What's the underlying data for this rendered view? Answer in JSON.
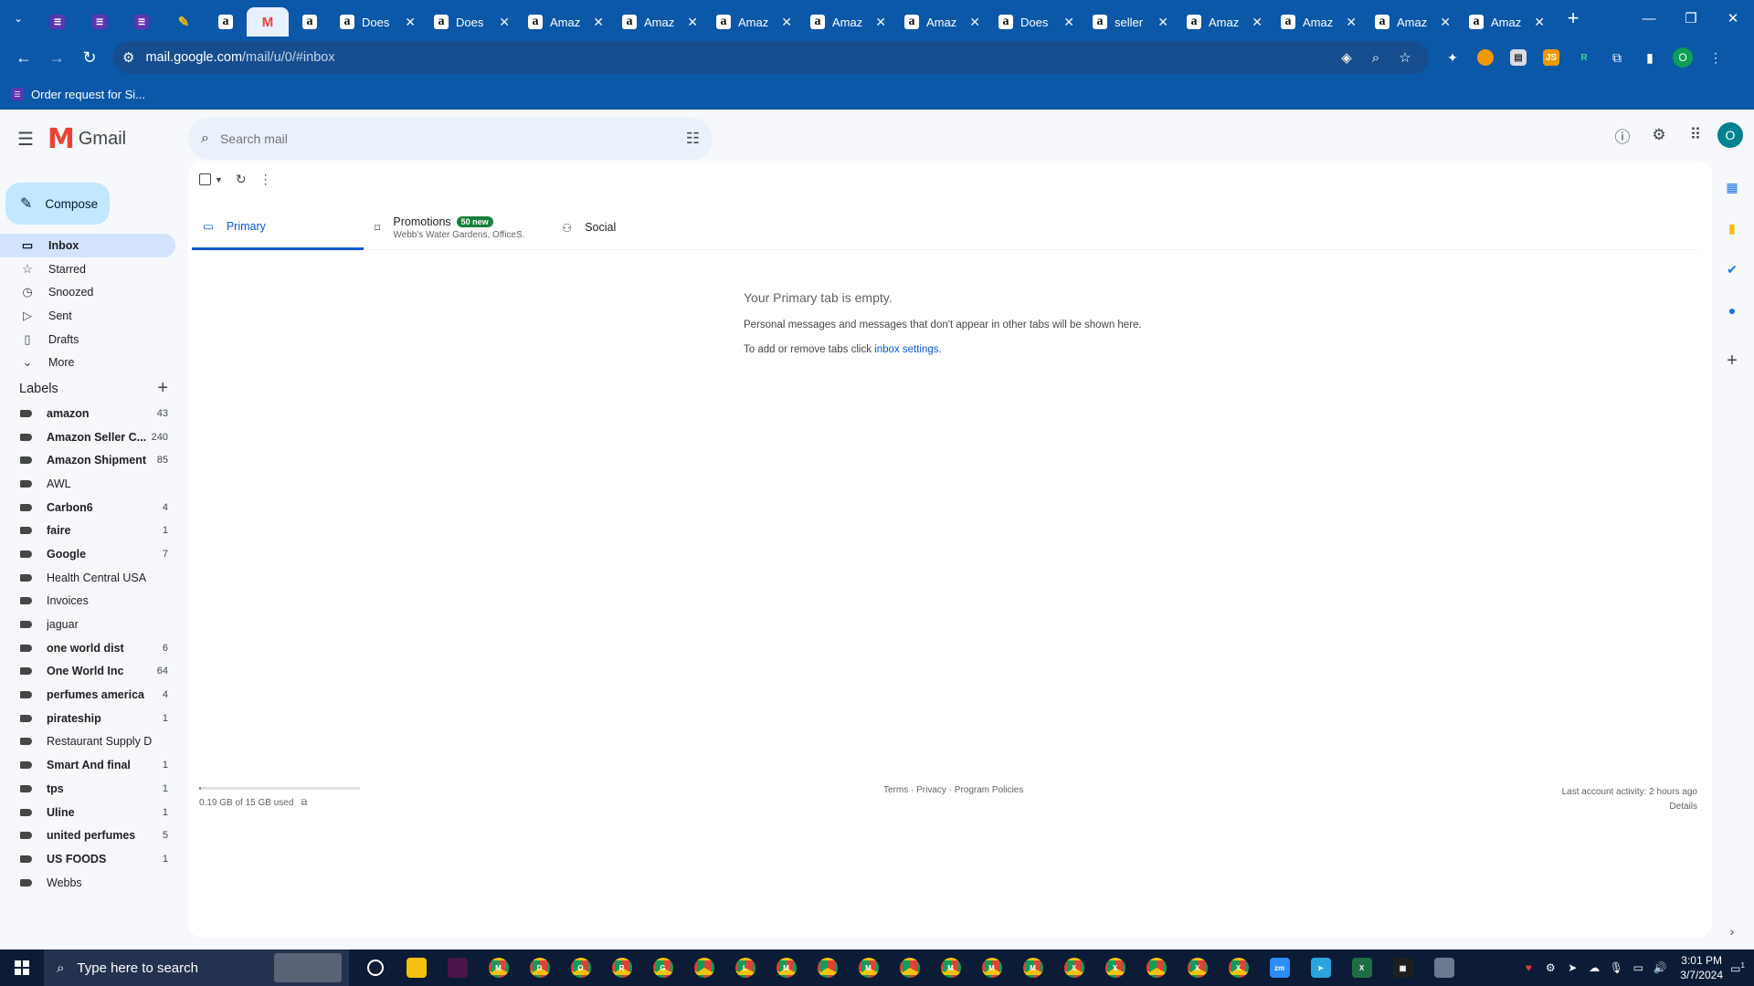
{
  "browser": {
    "tabs": [
      {
        "icon": "tab-search-icon",
        "title": "",
        "kind": "menu"
      },
      {
        "icon": "list-icon",
        "title": "",
        "kind": "pinned"
      },
      {
        "icon": "list-icon",
        "title": "",
        "kind": "pinned"
      },
      {
        "icon": "list-icon",
        "title": "",
        "kind": "pinned"
      },
      {
        "icon": "pen-icon",
        "title": "",
        "kind": "pinned"
      },
      {
        "icon": "amazon-icon",
        "title": "",
        "kind": "pinned"
      },
      {
        "icon": "gmail-icon",
        "title": "",
        "kind": "pinned-active"
      },
      {
        "icon": "amazon-icon",
        "title": "",
        "kind": "pinned"
      },
      {
        "icon": "amazon-icon",
        "title": "Does",
        "kind": "normal"
      },
      {
        "icon": "amazon-icon",
        "title": "Does",
        "kind": "normal"
      },
      {
        "icon": "amazon-icon",
        "title": "Amaz",
        "kind": "normal"
      },
      {
        "icon": "amazon-icon",
        "title": "Amaz",
        "kind": "normal"
      },
      {
        "icon": "amazon-icon",
        "title": "Amaz",
        "kind": "normal"
      },
      {
        "icon": "amazon-icon",
        "title": "Amaz",
        "kind": "normal"
      },
      {
        "icon": "amazon-icon",
        "title": "Amaz",
        "kind": "normal"
      },
      {
        "icon": "amazon-icon",
        "title": "Does",
        "kind": "normal"
      },
      {
        "icon": "amazon-icon",
        "title": "seller",
        "kind": "normal"
      },
      {
        "icon": "amazon-icon",
        "title": "Amaz",
        "kind": "normal"
      },
      {
        "icon": "amazon-icon",
        "title": "Amaz",
        "kind": "normal"
      },
      {
        "icon": "amazon-icon",
        "title": "Amaz",
        "kind": "normal"
      },
      {
        "icon": "amazon-icon",
        "title": "Amaz",
        "kind": "normal"
      }
    ],
    "new_tab_label": "+",
    "url_host": "mail.google.com",
    "url_path": "/mail/u/0/#inbox",
    "profile_initial": "O",
    "bookmark": "Order request for Si..."
  },
  "gmail": {
    "product": "Gmail",
    "compose": "Compose",
    "search_placeholder": "Search mail",
    "avatar_initial": "O",
    "nav": [
      {
        "label": "Inbox",
        "icon": "inbox-icon",
        "glyph": "▭",
        "active": true
      },
      {
        "label": "Starred",
        "icon": "star-icon",
        "glyph": "☆",
        "active": false
      },
      {
        "label": "Snoozed",
        "icon": "clock-icon",
        "glyph": "◷",
        "active": false
      },
      {
        "label": "Sent",
        "icon": "send-icon",
        "glyph": "▷",
        "active": false
      },
      {
        "label": "Drafts",
        "icon": "draft-icon",
        "glyph": "▯",
        "active": false
      },
      {
        "label": "More",
        "icon": "chevron-down-icon",
        "glyph": "⌄",
        "active": false
      }
    ],
    "labels_title": "Labels",
    "labels": [
      {
        "name": "amazon",
        "count": "43",
        "unread": true
      },
      {
        "name": "Amazon Seller C...",
        "count": "240",
        "unread": true
      },
      {
        "name": "Amazon Shipment",
        "count": "85",
        "unread": true
      },
      {
        "name": "AWL",
        "count": "",
        "unread": false
      },
      {
        "name": "Carbon6",
        "count": "4",
        "unread": true
      },
      {
        "name": "faire",
        "count": "1",
        "unread": true
      },
      {
        "name": "Google",
        "count": "7",
        "unread": true
      },
      {
        "name": "Health Central USA",
        "count": "",
        "unread": false
      },
      {
        "name": "Invoices",
        "count": "",
        "unread": false
      },
      {
        "name": "jaguar",
        "count": "",
        "unread": false
      },
      {
        "name": "one world dist",
        "count": "6",
        "unread": true
      },
      {
        "name": "One World Inc",
        "count": "64",
        "unread": true
      },
      {
        "name": "perfumes america",
        "count": "4",
        "unread": true
      },
      {
        "name": "pirateship",
        "count": "1",
        "unread": true
      },
      {
        "name": "Restaurant Supply D",
        "count": "",
        "unread": false
      },
      {
        "name": "Smart And final",
        "count": "1",
        "unread": true
      },
      {
        "name": "tps",
        "count": "1",
        "unread": true
      },
      {
        "name": "Uline",
        "count": "1",
        "unread": true
      },
      {
        "name": "united perfumes",
        "count": "5",
        "unread": true
      },
      {
        "name": "US FOODS",
        "count": "1",
        "unread": true
      },
      {
        "name": "Webbs",
        "count": "",
        "unread": false
      }
    ],
    "tabs": {
      "primary": "Primary",
      "promotions": "Promotions",
      "promotions_badge": "50 new",
      "promotions_snippet": "Webb's Water Gardens, OfficeS...",
      "social": "Social"
    },
    "empty": {
      "heading": "Your Primary tab is empty.",
      "line1": "Personal messages and messages that don't appear in other tabs will be shown here.",
      "line2_prefix": "To add or remove tabs click ",
      "line2_link": "inbox settings",
      "line2_suffix": "."
    },
    "footer": {
      "storage": "0.19 GB of 15 GB used",
      "storage_fraction": 0.013,
      "links": "Terms · Privacy · Program Policies",
      "activity": "Last account activity: 2 hours ago",
      "details": "Details"
    }
  },
  "taskbar": {
    "search_placeholder": "Type here to search",
    "apps": [
      {
        "icon": "cortana-icon",
        "letter": "",
        "color": "#0c1b36"
      },
      {
        "icon": "file-explorer-icon",
        "letter": "",
        "color": "#f4c20d"
      },
      {
        "icon": "slack-icon",
        "letter": "",
        "color": "#4a154b"
      },
      {
        "icon": "chrome-icon",
        "letter": "M",
        "color": "chrome"
      },
      {
        "icon": "chrome-icon",
        "letter": "D",
        "color": "chrome"
      },
      {
        "icon": "chrome-icon",
        "letter": "O",
        "color": "chrome"
      },
      {
        "icon": "chrome-icon",
        "letter": "R",
        "color": "chrome"
      },
      {
        "icon": "chrome-icon",
        "letter": "G",
        "color": "chrome"
      },
      {
        "icon": "chrome-icon",
        "letter": "",
        "color": "chrome"
      },
      {
        "icon": "chrome-icon",
        "letter": "L",
        "color": "chrome"
      },
      {
        "icon": "chrome-icon",
        "letter": "M",
        "color": "chrome"
      },
      {
        "icon": "chrome-icon",
        "letter": "",
        "color": "chrome"
      },
      {
        "icon": "chrome-icon",
        "letter": "M",
        "color": "chrome"
      },
      {
        "icon": "chrome-icon",
        "letter": "",
        "color": "chrome"
      },
      {
        "icon": "chrome-icon",
        "letter": "M",
        "color": "chrome"
      },
      {
        "icon": "chrome-icon",
        "letter": "M",
        "color": "chrome"
      },
      {
        "icon": "chrome-icon",
        "letter": "M",
        "color": "chrome"
      },
      {
        "icon": "chrome-icon",
        "letter": "X",
        "color": "chrome"
      },
      {
        "icon": "chrome-icon",
        "letter": "X",
        "color": "chrome"
      },
      {
        "icon": "chrome-icon",
        "letter": "",
        "color": "chrome"
      },
      {
        "icon": "chrome-icon",
        "letter": "X",
        "color": "chrome"
      },
      {
        "icon": "chrome-icon",
        "letter": "X",
        "color": "chrome"
      },
      {
        "icon": "zoom-icon",
        "letter": "zm",
        "color": "#2d8cff"
      },
      {
        "icon": "telegram-icon",
        "letter": "➤",
        "color": "#2aa3de"
      },
      {
        "icon": "excel-icon",
        "letter": "X",
        "color": "#1d6f42"
      },
      {
        "icon": "calculator-icon",
        "letter": "▦",
        "color": "#1f1f1f"
      },
      {
        "icon": "weather-icon",
        "letter": "",
        "color": "#6b7a90"
      }
    ],
    "time": "3:01 PM",
    "date": "3/7/2024",
    "notification_count": "1"
  },
  "colors": {
    "chrome_frame": "#0b57a8",
    "gmail_bg": "#f6f8fc",
    "active_nav": "#d3e3fd",
    "compose": "#c2e7ff",
    "accent": "#0b57d0",
    "badge_green": "#188038"
  }
}
